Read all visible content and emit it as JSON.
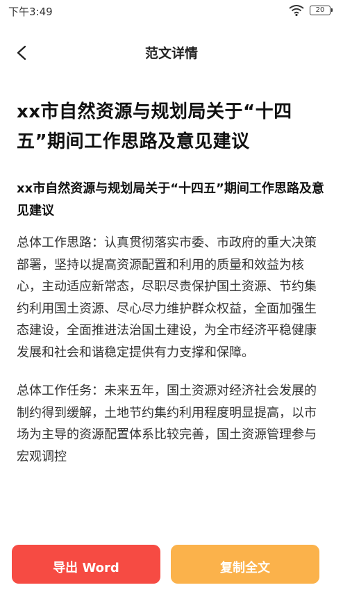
{
  "status_bar": {
    "time": "下午3:49",
    "battery": "20"
  },
  "nav": {
    "title": "范文详情",
    "back_icon": "chevron-left-icon"
  },
  "document": {
    "title": "xx市自然资源与规划局关于“十四五”期间工作思路及意见建议",
    "subtitle": "xx市自然资源与规划局关于“十四五”期间工作思路及意见建议",
    "paragraphs": [
      "总体工作思路：认真贯彻落实市委、市政府的重大决策部署，坚持以提高资源配置和利用的质量和效益为核心，主动适应新常态，尽职尽责保护国土资源、节约集约利用国土资源、尽心尽力维护群众权益，全面加强生态建设，全面推进法治国土建设，为全市经济平稳健康发展和社会和谐稳定提供有力支撑和保障。",
      "总体工作任务：未来五年，国土资源对经济社会发展的制约得到缓解，土地节约集约利用程度明显提高，以市场为主导的资源配置体系比较完善，国土资源管理参与宏观调控"
    ]
  },
  "actions": {
    "export_label": "导出 Word",
    "copy_label": "复制全文"
  },
  "colors": {
    "export_button": "#f64b43",
    "copy_button": "#fbb24b"
  }
}
